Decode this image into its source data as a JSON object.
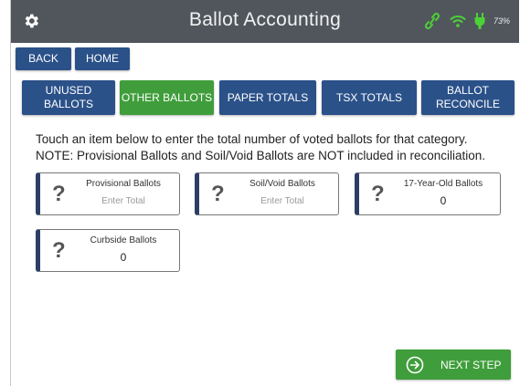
{
  "header": {
    "title": "Ballot Accounting",
    "battery_text": "73%"
  },
  "nav": {
    "back_label": "BACK",
    "home_label": "HOME"
  },
  "tabs": [
    {
      "label": "UNUSED BALLOTS",
      "active": false
    },
    {
      "label": "OTHER BALLOTS",
      "active": true
    },
    {
      "label": "PAPER TOTALS",
      "active": false
    },
    {
      "label": "TSX TOTALS",
      "active": false
    },
    {
      "label": "BALLOT RECONCILE",
      "active": false
    }
  ],
  "instructions": {
    "line1": "Touch an item below to enter the total number of voted ballots for that category.",
    "line2": "NOTE: Provisional Ballots and Soil/Void Ballots are NOT included in reconciliation."
  },
  "items": [
    {
      "label": "Provisional Ballots",
      "value": "Enter Total",
      "placeholder": true
    },
    {
      "label": "Soil/Void Ballots",
      "value": "Enter Total",
      "placeholder": true
    },
    {
      "label": "17-Year-Old Ballots",
      "value": "0",
      "placeholder": false
    },
    {
      "label": "Curbside Ballots",
      "value": "0",
      "placeholder": false
    }
  ],
  "footer": {
    "next_label": "NEXT STEP"
  },
  "colors": {
    "header_bg": "#50565c",
    "nav_blue": "#2b5189",
    "active_green": "#3f9e3b",
    "status_green": "#4cd137",
    "card_accent": "#2b3f66"
  }
}
